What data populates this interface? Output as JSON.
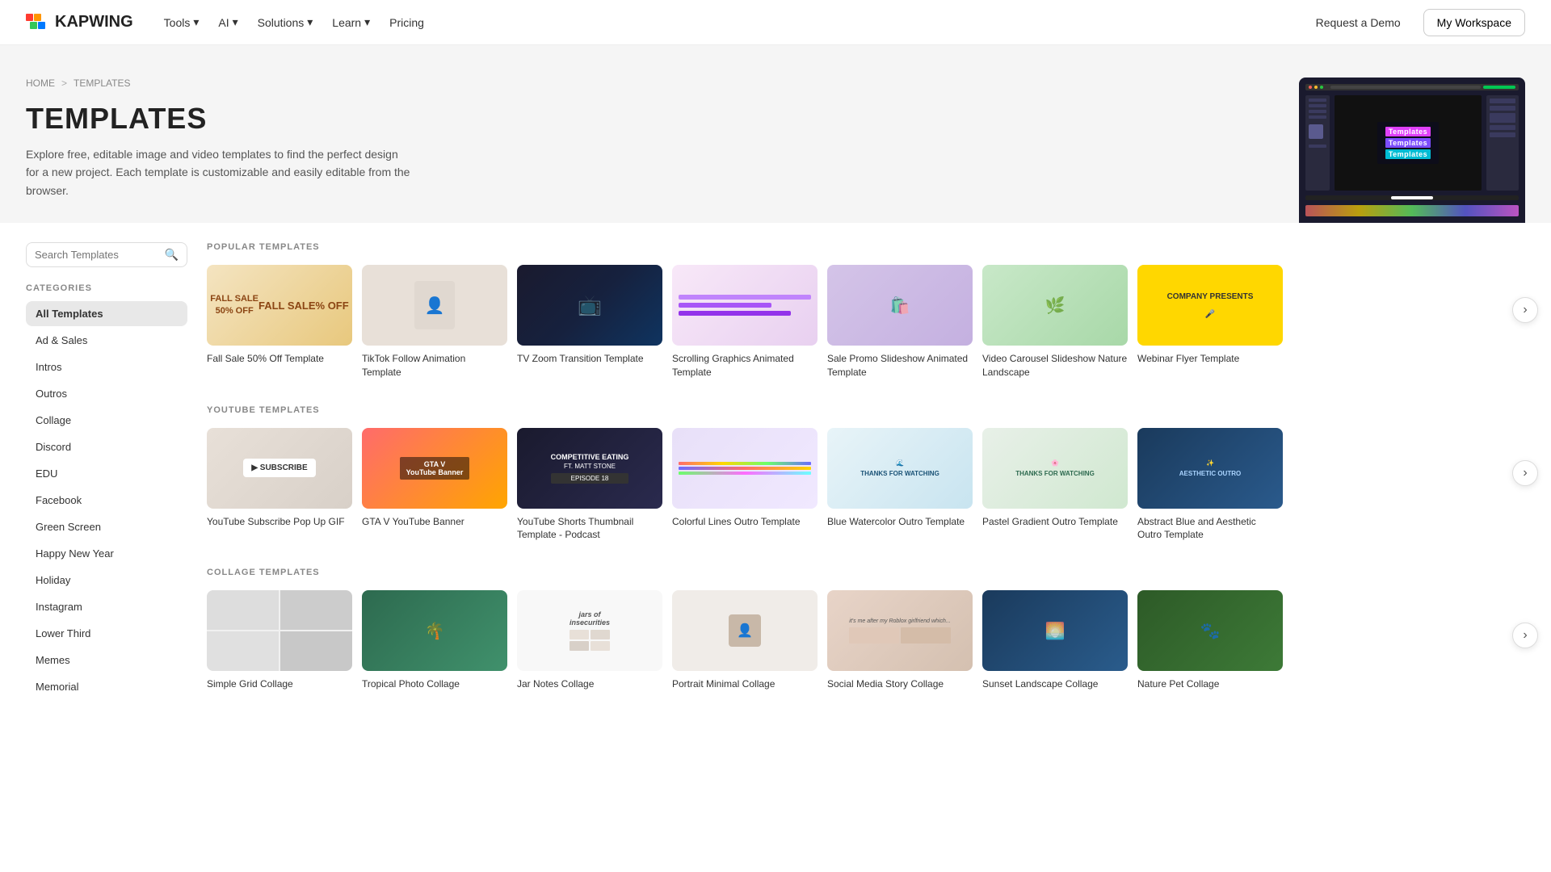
{
  "nav": {
    "logo_text": "KAPWING",
    "links": [
      {
        "label": "Tools",
        "has_dropdown": true
      },
      {
        "label": "AI",
        "has_dropdown": true
      },
      {
        "label": "Solutions",
        "has_dropdown": true
      },
      {
        "label": "Learn",
        "has_dropdown": true
      },
      {
        "label": "Pricing",
        "has_dropdown": false
      }
    ],
    "request_demo": "Request a Demo",
    "my_workspace": "My Workspace"
  },
  "hero": {
    "breadcrumb_home": "HOME",
    "breadcrumb_sep": ">",
    "breadcrumb_current": "TEMPLATES",
    "title": "TEMPLATES",
    "description": "Explore free, editable image and video templates to find the perfect design for a new project. Each template is customizable and easily editable from the browser.",
    "preview_texts": [
      "Templates",
      "Templates",
      "Templates"
    ]
  },
  "sidebar": {
    "search_placeholder": "Search Templates",
    "categories_label": "CATEGORIES",
    "items": [
      {
        "label": "All Templates",
        "active": true
      },
      {
        "label": "Ad & Sales",
        "active": false
      },
      {
        "label": "Intros",
        "active": false
      },
      {
        "label": "Outros",
        "active": false
      },
      {
        "label": "Collage",
        "active": false
      },
      {
        "label": "Discord",
        "active": false
      },
      {
        "label": "EDU",
        "active": false
      },
      {
        "label": "Facebook",
        "active": false
      },
      {
        "label": "Green Screen",
        "active": false
      },
      {
        "label": "Happy New Year",
        "active": false
      },
      {
        "label": "Holiday",
        "active": false
      },
      {
        "label": "Instagram",
        "active": false
      },
      {
        "label": "Lower Third",
        "active": false
      },
      {
        "label": "Memes",
        "active": false
      },
      {
        "label": "Memorial",
        "active": false
      }
    ]
  },
  "popular_section": {
    "label": "POPULAR TEMPLATES",
    "templates": [
      {
        "title": "Fall Sale 50% Off Template",
        "thumb_class": "thumb-fall-sale"
      },
      {
        "title": "TikTok Follow Animation Template",
        "thumb_class": "thumb-tiktok"
      },
      {
        "title": "TV Zoom Transition Template",
        "thumb_class": "thumb-tv-zoom"
      },
      {
        "title": "Scrolling Graphics Animated Template",
        "thumb_class": "thumb-scrolling"
      },
      {
        "title": "Sale Promo Slideshow Animated Template",
        "thumb_class": "thumb-sale-promo"
      },
      {
        "title": "Video Carousel Slideshow Nature Landscape",
        "thumb_class": "thumb-video-carousel"
      },
      {
        "title": "Webinar Flyer Template",
        "thumb_class": "thumb-webinar"
      }
    ]
  },
  "youtube_section": {
    "label": "YOUTUBE TEMPLATES",
    "templates": [
      {
        "title": "YouTube Subscribe Pop Up GIF",
        "thumb_class": "thumb-yt-subscribe"
      },
      {
        "title": "GTA V YouTube Banner",
        "thumb_class": "thumb-gta"
      },
      {
        "title": "YouTube Shorts Thumbnail Template - Podcast",
        "thumb_class": "thumb-yt-shorts"
      },
      {
        "title": "Colorful Lines Outro Template",
        "thumb_class": "thumb-colorful"
      },
      {
        "title": "Blue Watercolor Outro Template",
        "thumb_class": "thumb-blue-watercolor"
      },
      {
        "title": "Pastel Gradient Outro Template",
        "thumb_class": "thumb-pastel"
      },
      {
        "title": "Abstract Blue and Aesthetic Outro Template",
        "thumb_class": "thumb-abstract-blue"
      }
    ]
  },
  "collage_section": {
    "label": "COLLAGE TEMPLATES",
    "templates": [
      {
        "title": "Simple Grid Collage",
        "thumb_class": "thumb-collage1"
      },
      {
        "title": "Tropical Photo Collage",
        "thumb_class": "thumb-collage2"
      },
      {
        "title": "Jar Notes Collage",
        "thumb_class": "thumb-collage3"
      },
      {
        "title": "Portrait Minimal Collage",
        "thumb_class": "thumb-collage4"
      },
      {
        "title": "Social Media Story Collage",
        "thumb_class": "thumb-collage5"
      },
      {
        "title": "Sunset Landscape Collage",
        "thumb_class": "thumb-collage6"
      },
      {
        "title": "Nature Pet Collage",
        "thumb_class": "thumb-collage7"
      }
    ]
  }
}
